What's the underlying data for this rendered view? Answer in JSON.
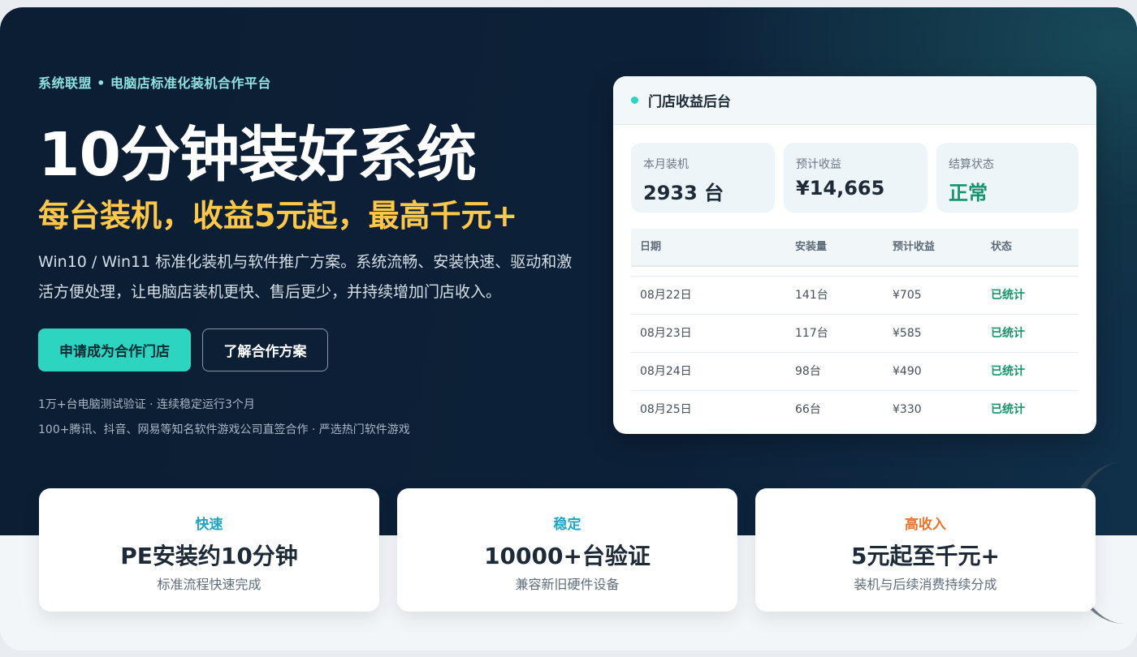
{
  "hero": {
    "eyebrow": "系统联盟 • 电脑店标准化装机合作平台",
    "headline": "10分钟装好系统",
    "subhead": "每台装机，收益5元起，最高千元+",
    "description": "Win10 / Win11 标准化装机与软件推广方案。系统流畅、安装快速、驱动和激活方便处理，让电脑店装机更快、售后更少，并持续增加门店收入。",
    "primary_button": "申请成为合作门店",
    "secondary_button": "了解合作方案",
    "proof_1": "1万+台电脑测试验证 · 连续稳定运行3个月",
    "proof_2": "100+腾讯、抖音、网易等知名软件游戏公司直签合作 · 严选热门软件游戏"
  },
  "dashboard": {
    "title": "门店收益后台",
    "stats": [
      {
        "label": "本月装机",
        "value": "2933 台"
      },
      {
        "label": "预计收益",
        "value": "¥14,665"
      },
      {
        "label": "结算状态",
        "value": "正常"
      }
    ],
    "table": {
      "headers": [
        "日期",
        "安装量",
        "预计收益",
        "状态"
      ],
      "rows": [
        [
          "08月22日",
          "141台",
          "¥705",
          "已统计"
        ],
        [
          "08月23日",
          "117台",
          "¥585",
          "已统计"
        ],
        [
          "08月24日",
          "98台",
          "¥490",
          "已统计"
        ],
        [
          "08月25日",
          "66台",
          "¥330",
          "已统计"
        ]
      ]
    }
  },
  "features": [
    {
      "tag": "快速",
      "title": "PE安装约10分钟",
      "subtitle": "标准流程快速完成",
      "color": "#1ea6c7"
    },
    {
      "tag": "稳定",
      "title": "10000+台验证",
      "subtitle": "兼容新旧硬件设备",
      "color": "#1ea6c7"
    },
    {
      "tag": "高收入",
      "title": "5元起至千元+",
      "subtitle": "装机与后续消费持续分成",
      "color": "#e8742c"
    }
  ],
  "colors": {
    "accent": "#2dd4c0",
    "highlight": "#ffc84a",
    "status_ok": "#17946b",
    "hero_bg": "#0b1e33"
  }
}
